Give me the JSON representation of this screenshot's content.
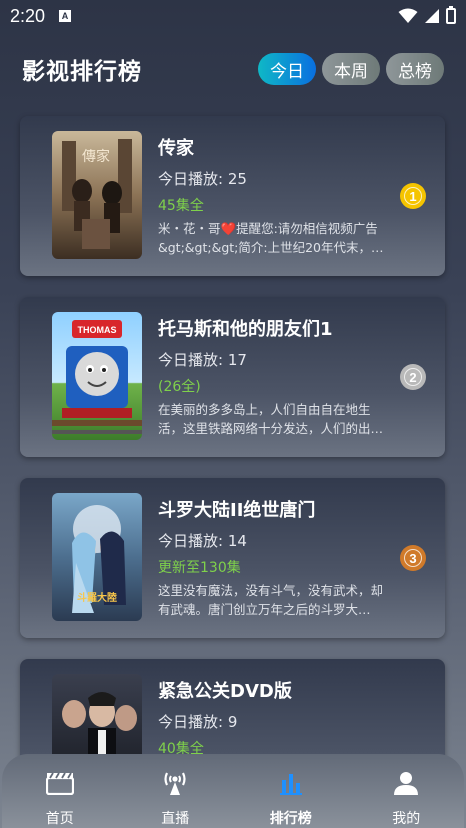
{
  "status": {
    "time": "2:20",
    "notification": "A"
  },
  "header": {
    "title": "影视排行榜",
    "tabs": [
      {
        "label": "今日",
        "active": true
      },
      {
        "label": "本周",
        "active": false
      },
      {
        "label": "总榜",
        "active": false
      }
    ]
  },
  "items": [
    {
      "title": "传家",
      "plays": "今日播放: 25",
      "episodes": "45集全",
      "desc": "米・花・哥❤️提醒您:请勿相信视频广告&gt;&gt;&gt;简介:上世纪20年代末，上…",
      "rank": "1",
      "rank_color": "#f5c400"
    },
    {
      "title": "托马斯和他的朋友们1",
      "plays": "今日播放: 17",
      "episodes": "(26全)",
      "desc": "在美丽的多多岛上，人们自由自在地生活，这里铁路网络十分发达，人们的出…",
      "rank": "2",
      "rank_color": "#b9b9b9"
    },
    {
      "title": "斗罗大陆II绝世唐门",
      "plays": "今日播放: 14",
      "episodes": "更新至130集",
      "desc": "这里没有魔法，没有斗气，没有武术，却有武魂。唐门创立万年之后的斗罗大…",
      "rank": "3",
      "rank_color": "#d07a2a"
    },
    {
      "title": "紧急公关DVD版",
      "plays": "今日播放: 9",
      "episodes": "40集全",
      "desc": "",
      "rank": "",
      "rank_color": ""
    }
  ],
  "nav": [
    {
      "label": "首页",
      "icon": "clapperboard-icon",
      "active": false
    },
    {
      "label": "直播",
      "icon": "live-antenna-icon",
      "active": false
    },
    {
      "label": "排行榜",
      "icon": "bar-chart-icon",
      "active": true
    },
    {
      "label": "我的",
      "icon": "person-icon",
      "active": false
    }
  ],
  "colors": {
    "accent": "#1e90ff",
    "episodes": "#7fd14b"
  }
}
